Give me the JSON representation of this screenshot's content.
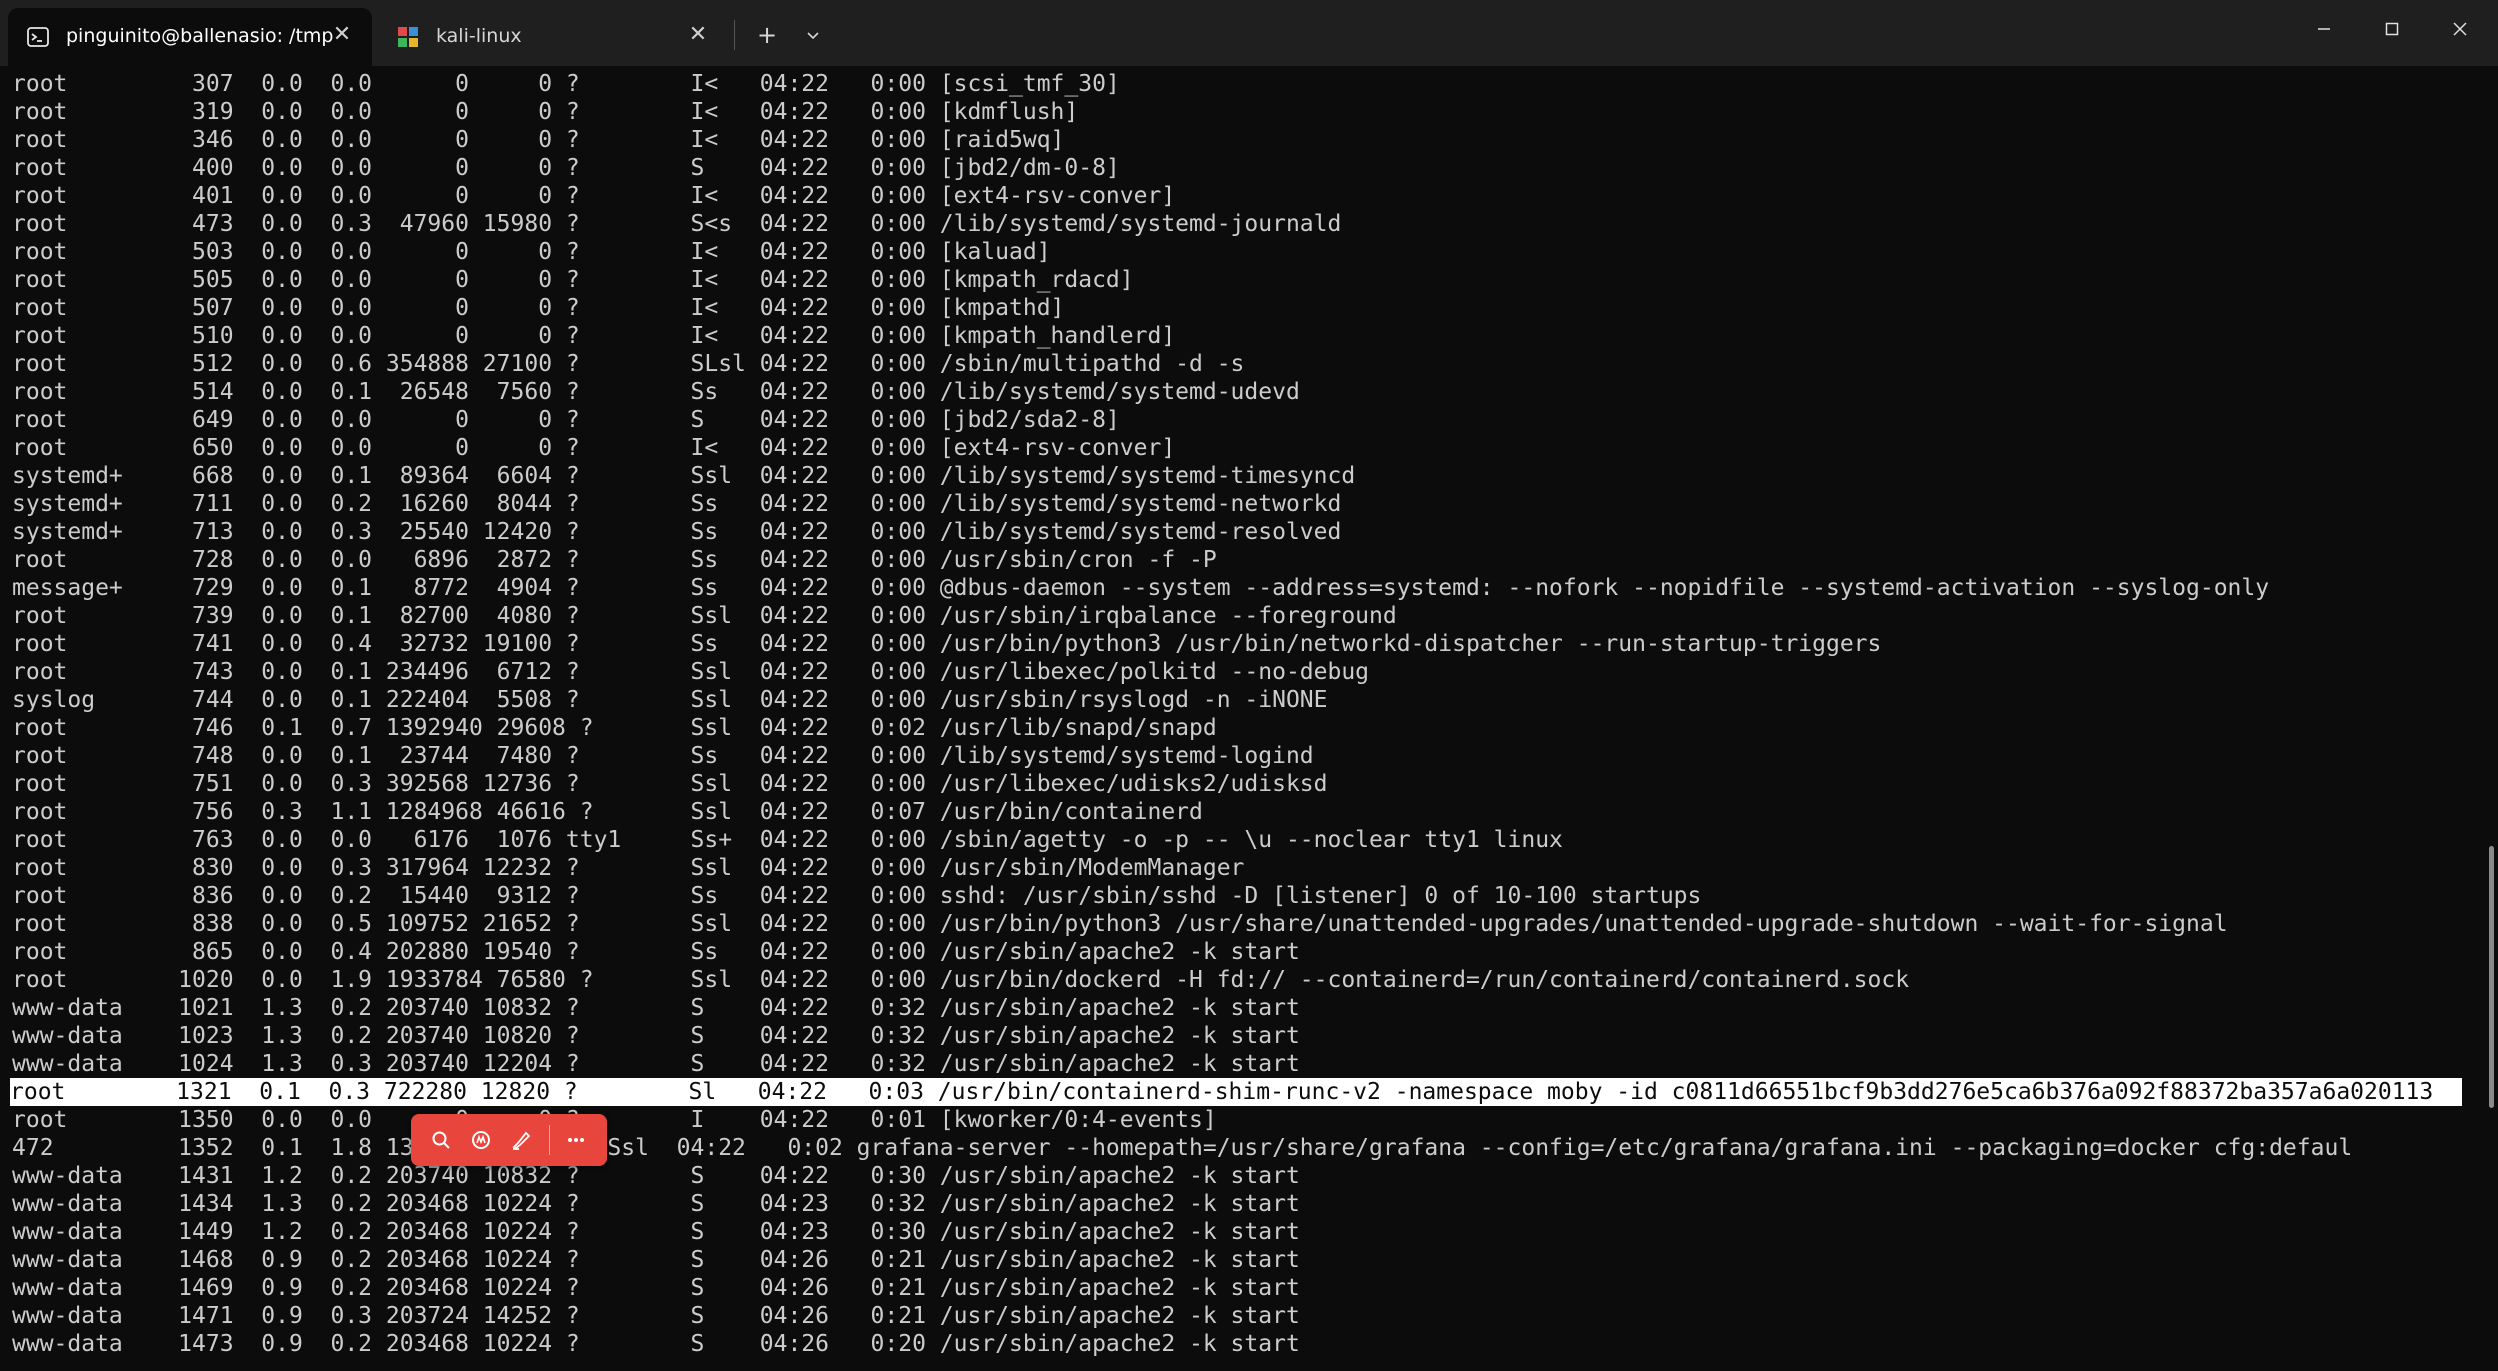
{
  "tabs": [
    {
      "title": "pinguinito@ballenasio: /tmp",
      "icon": "terminal-icon",
      "active": true
    },
    {
      "title": "kali-linux",
      "icon": "kali-linux-icon",
      "active": false
    }
  ],
  "tab_controls": {
    "new_tab": "+",
    "dropdown": "⌄"
  },
  "window_controls": {
    "minimize": "—",
    "maximize": "☐",
    "close": "✕"
  },
  "colors": {
    "terminal_bg": "#0c0c0c",
    "terminal_fg": "#cccccc",
    "toolbar_accent": "#e8453c",
    "selection_bg": "#ffffff"
  },
  "terminal": {
    "selected_line_index": 36,
    "lines": [
      "root         307  0.0  0.0      0     0 ?        I<   04:22   0:00 [scsi_tmf_30]",
      "root         319  0.0  0.0      0     0 ?        I<   04:22   0:00 [kdmflush]",
      "root         346  0.0  0.0      0     0 ?        I<   04:22   0:00 [raid5wq]",
      "root         400  0.0  0.0      0     0 ?        S    04:22   0:00 [jbd2/dm-0-8]",
      "root         401  0.0  0.0      0     0 ?        I<   04:22   0:00 [ext4-rsv-conver]",
      "root         473  0.0  0.3  47960 15980 ?        S<s  04:22   0:00 /lib/systemd/systemd-journald",
      "root         503  0.0  0.0      0     0 ?        I<   04:22   0:00 [kaluad]",
      "root         505  0.0  0.0      0     0 ?        I<   04:22   0:00 [kmpath_rdacd]",
      "root         507  0.0  0.0      0     0 ?        I<   04:22   0:00 [kmpathd]",
      "root         510  0.0  0.0      0     0 ?        I<   04:22   0:00 [kmpath_handlerd]",
      "root         512  0.0  0.6 354888 27100 ?        SLsl 04:22   0:00 /sbin/multipathd -d -s",
      "root         514  0.0  0.1  26548  7560 ?        Ss   04:22   0:00 /lib/systemd/systemd-udevd",
      "root         649  0.0  0.0      0     0 ?        S    04:22   0:00 [jbd2/sda2-8]",
      "root         650  0.0  0.0      0     0 ?        I<   04:22   0:00 [ext4-rsv-conver]",
      "systemd+     668  0.0  0.1  89364  6604 ?        Ssl  04:22   0:00 /lib/systemd/systemd-timesyncd",
      "systemd+     711  0.0  0.2  16260  8044 ?        Ss   04:22   0:00 /lib/systemd/systemd-networkd",
      "systemd+     713  0.0  0.3  25540 12420 ?        Ss   04:22   0:00 /lib/systemd/systemd-resolved",
      "root         728  0.0  0.0   6896  2872 ?        Ss   04:22   0:00 /usr/sbin/cron -f -P",
      "message+     729  0.0  0.1   8772  4904 ?        Ss   04:22   0:00 @dbus-daemon --system --address=systemd: --nofork --nopidfile --systemd-activation --syslog-only",
      "root         739  0.0  0.1  82700  4080 ?        Ssl  04:22   0:00 /usr/sbin/irqbalance --foreground",
      "root         741  0.0  0.4  32732 19100 ?        Ss   04:22   0:00 /usr/bin/python3 /usr/bin/networkd-dispatcher --run-startup-triggers",
      "root         743  0.0  0.1 234496  6712 ?        Ssl  04:22   0:00 /usr/libexec/polkitd --no-debug",
      "syslog       744  0.0  0.1 222404  5508 ?        Ssl  04:22   0:00 /usr/sbin/rsyslogd -n -iNONE",
      "root         746  0.1  0.7 1392940 29608 ?       Ssl  04:22   0:02 /usr/lib/snapd/snapd",
      "root         748  0.0  0.1  23744  7480 ?        Ss   04:22   0:00 /lib/systemd/systemd-logind",
      "root         751  0.0  0.3 392568 12736 ?        Ssl  04:22   0:00 /usr/libexec/udisks2/udisksd",
      "root         756  0.3  1.1 1284968 46616 ?       Ssl  04:22   0:07 /usr/bin/containerd",
      "root         763  0.0  0.0   6176  1076 tty1     Ss+  04:22   0:00 /sbin/agetty -o -p -- \\u --noclear tty1 linux",
      "root         830  0.0  0.3 317964 12232 ?        Ssl  04:22   0:00 /usr/sbin/ModemManager",
      "root         836  0.0  0.2  15440  9312 ?        Ss   04:22   0:00 sshd: /usr/sbin/sshd -D [listener] 0 of 10-100 startups",
      "root         838  0.0  0.5 109752 21652 ?        Ssl  04:22   0:00 /usr/bin/python3 /usr/share/unattended-upgrades/unattended-upgrade-shutdown --wait-for-signal",
      "root         865  0.0  0.4 202880 19540 ?        Ss   04:22   0:00 /usr/sbin/apache2 -k start",
      "root        1020  0.0  1.9 1933784 76580 ?       Ssl  04:22   0:00 /usr/bin/dockerd -H fd:// --containerd=/run/containerd/containerd.sock",
      "www-data    1021  1.3  0.2 203740 10832 ?        S    04:22   0:32 /usr/sbin/apache2 -k start",
      "www-data    1023  1.3  0.2 203740 10820 ?        S    04:22   0:32 /usr/sbin/apache2 -k start",
      "www-data    1024  1.3  0.3 203740 12204 ?        S    04:22   0:32 /usr/sbin/apache2 -k start",
      "root        1321  0.1  0.3 722280 12820 ?        Sl   04:22   0:03 /usr/bin/containerd-shim-runc-v2 -namespace moby -id c0811d66551bcf9b3dd276e5ca6b376a092f88372ba357a6a020113",
      "root        1350  0.0  0.0      0     0 ?        I    04:22   0:01 [kworker/0:4-events]",
      "472         1352  0.1  1.8 13              Ssl  04:22   0:02 grafana-server --homepath=/usr/share/grafana --config=/etc/grafana/grafana.ini --packaging=docker cfg:defaul",
      "www-data    1431  1.2  0.2 203740 10832 ?        S    04:22   0:30 /usr/sbin/apache2 -k start",
      "www-data    1434  1.3  0.2 203468 10224 ?        S    04:23   0:32 /usr/sbin/apache2 -k start",
      "www-data    1449  1.2  0.2 203468 10224 ?        S    04:23   0:30 /usr/sbin/apache2 -k start",
      "www-data    1468  0.9  0.2 203468 10224 ?        S    04:26   0:21 /usr/sbin/apache2 -k start",
      "www-data    1469  0.9  0.2 203468 10224 ?        S    04:26   0:21 /usr/sbin/apache2 -k start",
      "www-data    1471  0.9  0.3 203724 14252 ?        S    04:26   0:21 /usr/sbin/apache2 -k start",
      "www-data    1473  0.9  0.2 203468 10224 ?        S    04:26   0:20 /usr/sbin/apache2 -k start"
    ]
  },
  "floating_toolbar": {
    "buttons": [
      {
        "icon": "search-icon"
      },
      {
        "icon": "ai-assistant-icon"
      },
      {
        "icon": "highlighter-icon"
      },
      {
        "icon": "more-icon"
      }
    ]
  }
}
